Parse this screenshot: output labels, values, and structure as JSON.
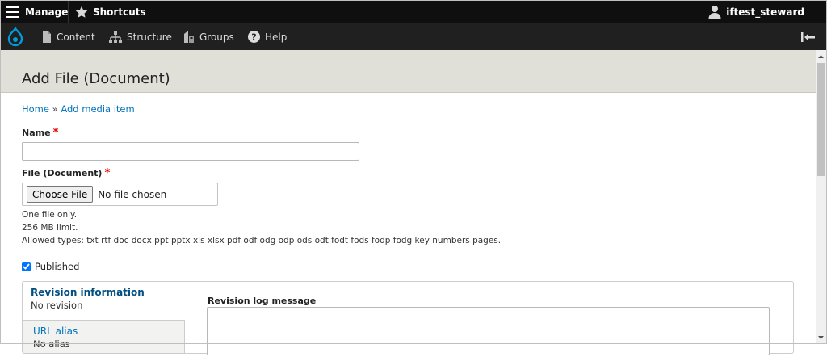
{
  "toolbar": {
    "manage": "Manage",
    "shortcuts": "Shortcuts",
    "user": "iftest_steward"
  },
  "menu": {
    "items": [
      {
        "label": "Content",
        "icon": "page-icon"
      },
      {
        "label": "Structure",
        "icon": "sitemap-icon"
      },
      {
        "label": "Groups",
        "icon": "groups-icon"
      },
      {
        "label": "Help",
        "icon": "help-icon"
      }
    ]
  },
  "page": {
    "title": "Add File (Document)"
  },
  "breadcrumb": {
    "home": "Home",
    "separator": " » ",
    "current": "Add media item"
  },
  "form": {
    "name_label": "Name",
    "name_value": "",
    "required_mark": "*",
    "file_label": "File (Document)",
    "choose_file": "Choose File",
    "no_file": "No file chosen",
    "desc_one": "One file only.",
    "desc_limit": "256 MB limit.",
    "desc_types": "Allowed types: txt rtf doc docx ppt pptx xls xlsx pdf odf odg odp ods odt fodt fods fodp fodg key numbers pages.",
    "published_label": "Published",
    "published_checked": true
  },
  "vtabs": {
    "revision_title": "Revision information",
    "revision_summary": "No revision",
    "alias_title": "URL alias",
    "alias_summary": "No alias",
    "revision_log_label": "Revision log message"
  },
  "colors": {
    "toolbar_bg": "#0f0f0f",
    "subbar_bg": "#202020",
    "header_bg": "#e0e0d8",
    "link": "#0074bd",
    "required": "#ee0000",
    "drupal_blue": "#009cde"
  }
}
